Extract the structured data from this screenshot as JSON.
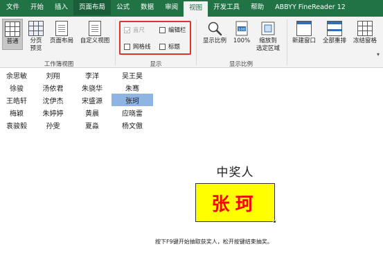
{
  "menu": {
    "tabs": [
      "文件",
      "开始",
      "插入",
      "页面布局",
      "公式",
      "数据",
      "审阅",
      "视图",
      "开发工具",
      "帮助",
      "ABBYY FineReader 12"
    ],
    "active_tab": "视图"
  },
  "ribbon": {
    "workbook_views": {
      "label": "工作簿视图",
      "normal": "普通",
      "page_break": [
        "分页",
        "预览"
      ],
      "page_layout": "页面布局",
      "custom_views": "自定义视图"
    },
    "show": {
      "label": "显示",
      "ruler": {
        "label": "直尺",
        "checked": true,
        "enabled": false
      },
      "formula_bar": {
        "label": "编辑栏",
        "checked": false,
        "enabled": true
      },
      "gridlines": {
        "label": "网格线",
        "checked": false,
        "enabled": true
      },
      "headings": {
        "label": "标题",
        "checked": false,
        "enabled": true
      }
    },
    "zoom": {
      "label": "显示比例",
      "zoom": "显示比例",
      "zoom_100": "100%",
      "zoom_selection": [
        "缩放到",
        "选定区域"
      ]
    },
    "window": {
      "new_window": "新建窗口",
      "arrange_all": "全部重排",
      "freeze_panes": "冻结窗格"
    }
  },
  "sheet": {
    "names": [
      [
        "余思敏",
        "刘翔",
        "李洋",
        "吴王昊"
      ],
      [
        "徐骏",
        "汤依君",
        "朱骁华",
        "朱骞"
      ],
      [
        "王皓轩",
        "沈伊杰",
        "宋盛源",
        "张珂"
      ],
      [
        "梅颖",
        "朱婷婷",
        "黄晨",
        "应晓雷"
      ],
      [
        "袁骏毅",
        "孙雯",
        "夏淼",
        "杨文傲"
      ]
    ],
    "selected_name": "张珂",
    "prize_title": "中奖人",
    "winner": "张珂",
    "hint": "按下F9键开始抽取获奖人，松开按键结束抽奖。"
  },
  "colors": {
    "brand_green": "#217346",
    "winner_bg": "#ffff00",
    "winner_text": "#ff0000",
    "selection_blue": "#8eb4e3",
    "highlight_frame": "#e03030"
  }
}
